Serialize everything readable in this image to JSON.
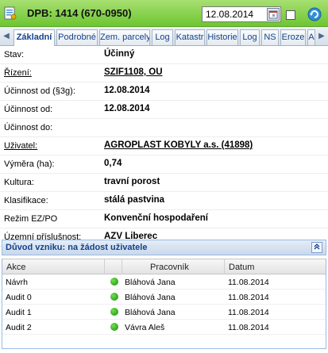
{
  "header": {
    "title": "DPB: 1414 (670-0950)",
    "date_value": "12.08.2014",
    "accent_color": "#6dc531"
  },
  "tabs": [
    {
      "label": "Základní",
      "active": true
    },
    {
      "label": "Podrobné",
      "active": false
    },
    {
      "label": "Zem. parcely",
      "active": false
    },
    {
      "label": "Log",
      "active": false
    },
    {
      "label": "Katastr",
      "active": false
    },
    {
      "label": "Historie",
      "active": false
    },
    {
      "label": "Log",
      "active": false
    },
    {
      "label": "NS",
      "active": false
    },
    {
      "label": "Eroze",
      "active": false
    },
    {
      "label": "A",
      "active": false
    }
  ],
  "fields": [
    {
      "label": "Stav:",
      "value": "Účinný",
      "label_link": false,
      "value_link": false
    },
    {
      "label": "Řízení:",
      "value": "SZIF1108, OU",
      "label_link": true,
      "value_link": true
    },
    {
      "label": "Účinnost od (§3g):",
      "value": "12.08.2014",
      "label_link": false,
      "value_link": false
    },
    {
      "label": "Účinnost od:",
      "value": "12.08.2014",
      "label_link": false,
      "value_link": false
    },
    {
      "label": "Účinnost do:",
      "value": "",
      "label_link": false,
      "value_link": false
    },
    {
      "label": "Uživatel:",
      "value": "AGROPLAST KOBYLY a.s. (41898)",
      "label_link": true,
      "value_link": true
    },
    {
      "label": "Výměra (ha):",
      "value": "0,74",
      "label_link": false,
      "value_link": false
    },
    {
      "label": "Kultura:",
      "value": "travní porost",
      "label_link": false,
      "value_link": false
    },
    {
      "label": "Klasifikace:",
      "value": "stálá pastvina",
      "label_link": false,
      "value_link": false
    },
    {
      "label": "Režim EZ/PO",
      "value": "Konvenční hospodaření",
      "label_link": false,
      "value_link": false
    },
    {
      "label": "Územní příslušnost:",
      "value": "AZV Liberec",
      "label_link": false,
      "value_link": false
    }
  ],
  "reason_panel": {
    "title": "Důvod vzniku: na žádost uživatele"
  },
  "audit_grid": {
    "columns": [
      "Akce",
      "Pracovník",
      "Datum"
    ],
    "rows": [
      {
        "akce": "Návrh",
        "status": "green",
        "pracovnik": "Bláhová Jana",
        "datum": "11.08.2014"
      },
      {
        "akce": "Audit 0",
        "status": "green",
        "pracovnik": "Bláhová Jana",
        "datum": "11.08.2014"
      },
      {
        "akce": "Audit 1",
        "status": "green",
        "pracovnik": "Bláhová Jana",
        "datum": "11.08.2014"
      },
      {
        "akce": "Audit 2",
        "status": "green",
        "pracovnik": "Vávra Aleš",
        "datum": "11.08.2014"
      }
    ]
  }
}
